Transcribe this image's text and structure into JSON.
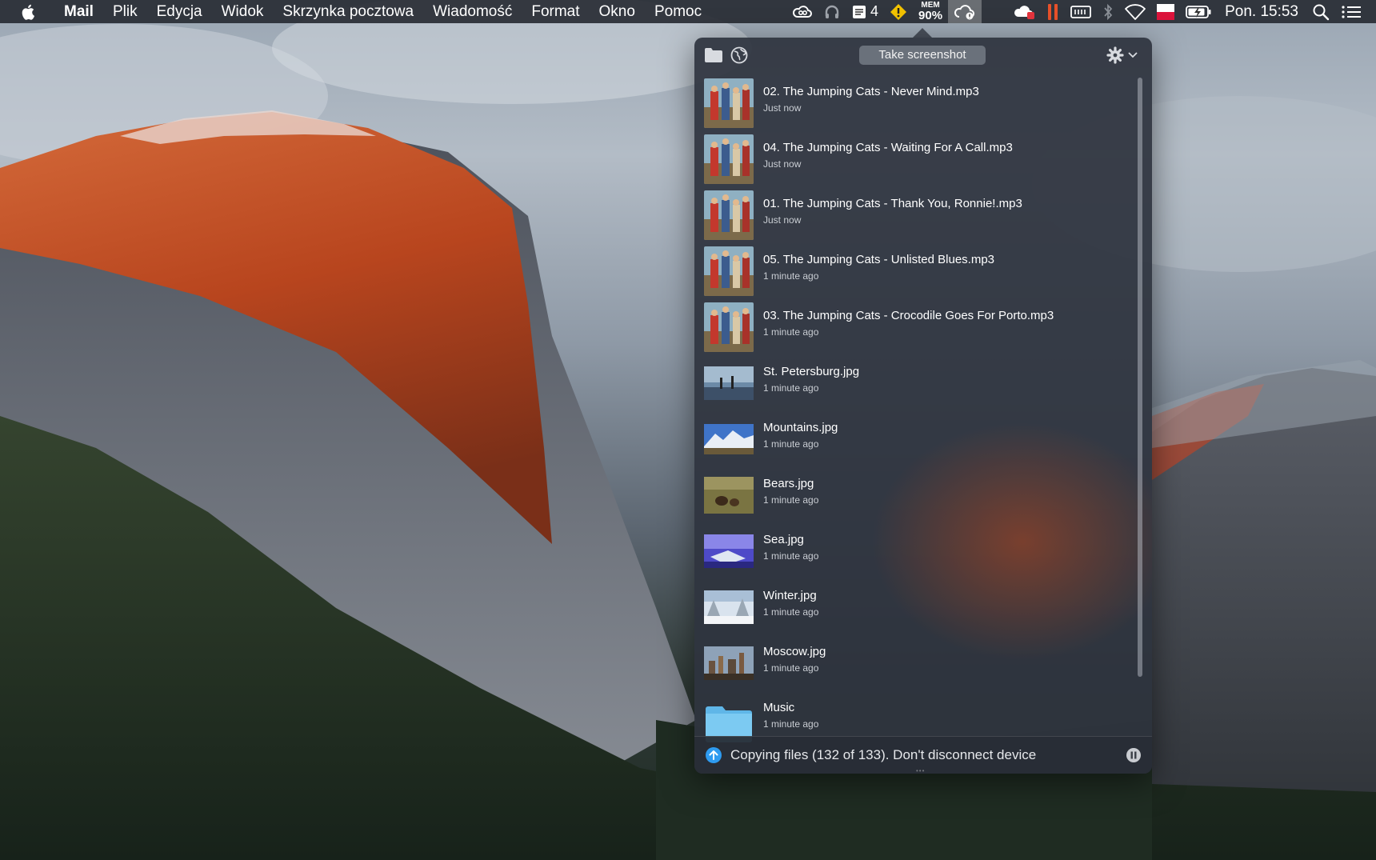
{
  "menubar": {
    "app_name": "Mail",
    "items": [
      "Plik",
      "Edycja",
      "Widok",
      "Skrzynka pocztowa",
      "Wiadomość",
      "Format",
      "Okno",
      "Pomoc"
    ],
    "status": {
      "notes_count": "4",
      "mem_label": "MEM",
      "mem_value": "90%",
      "clock": "Pon. 15:53"
    }
  },
  "popover": {
    "take_screenshot_label": "Take screenshot",
    "files": [
      {
        "name": "02. The Jumping Cats - Never Mind.mp3",
        "time": "Just now",
        "thumb": "album"
      },
      {
        "name": "04. The Jumping Cats - Waiting For A Call.mp3",
        "time": "Just now",
        "thumb": "album"
      },
      {
        "name": "01. The Jumping Cats - Thank You, Ronnie!.mp3",
        "time": "Just now",
        "thumb": "album"
      },
      {
        "name": "05. The Jumping Cats - Unlisted Blues.mp3",
        "time": "1 minute ago",
        "thumb": "album"
      },
      {
        "name": "03. The Jumping Cats - Crocodile Goes For Porto.mp3",
        "time": "1 minute ago",
        "thumb": "album"
      },
      {
        "name": "St. Petersburg.jpg",
        "time": "1 minute ago",
        "thumb": "petersburg"
      },
      {
        "name": "Mountains.jpg",
        "time": "1 minute ago",
        "thumb": "mountains"
      },
      {
        "name": "Bears.jpg",
        "time": "1 minute ago",
        "thumb": "bears"
      },
      {
        "name": "Sea.jpg",
        "time": "1 minute ago",
        "thumb": "sea"
      },
      {
        "name": "Winter.jpg",
        "time": "1 minute ago",
        "thumb": "winter"
      },
      {
        "name": "Moscow.jpg",
        "time": "1 minute ago",
        "thumb": "moscow"
      },
      {
        "name": "Music",
        "time": "1 minute ago",
        "thumb": "folder"
      }
    ],
    "status_text": "Copying files (132 of 133). Don't disconnect device"
  }
}
